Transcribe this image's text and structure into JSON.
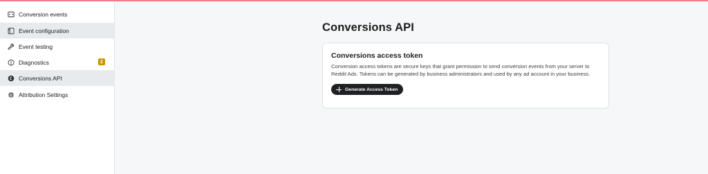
{
  "sidebar": {
    "items": [
      {
        "label": "Conversion events",
        "icon": "code-window-icon",
        "active": false
      },
      {
        "label": "Event configuration",
        "icon": "config-window-icon",
        "active": true
      },
      {
        "label": "Event testing",
        "icon": "wrench-icon",
        "active": false
      },
      {
        "label": "Diagnostics",
        "icon": "info-circle-icon",
        "active": false,
        "badge": "2"
      },
      {
        "label": "Conversions API",
        "icon": "api-cloud-icon",
        "active": true
      },
      {
        "label": "Attribution Settings",
        "icon": "gear-icon",
        "active": false
      }
    ]
  },
  "main": {
    "title": "Conversions API",
    "card": {
      "title": "Conversions access token",
      "description": "Conversion access tokens are secure keys that grant permission to send conversion events from your server to Reddit Ads. Tokens can be generated by business administrators and used by any ad account in your business.",
      "button_label": "Generate Access Token"
    }
  },
  "colors": {
    "accent_bar": "#f07a8a",
    "badge": "#c99400",
    "button_bg": "#1f2023",
    "active_nav": "#e8eaed"
  }
}
